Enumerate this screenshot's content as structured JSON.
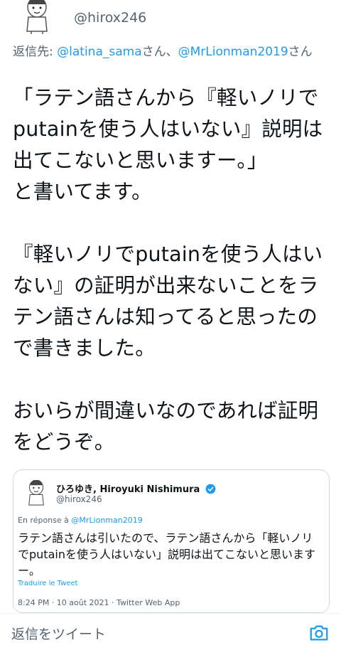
{
  "header": {
    "handle": "@hirox246"
  },
  "reply_to": {
    "prefix": "返信先: ",
    "mention1": "@latina_sama",
    "sep": "さん、",
    "mention2": "@MrLionman2019",
    "suffix": "さん"
  },
  "tweet": {
    "paragraphs": [
      "「ラテン語さんから『軽いノリで\nputainを使う人はいない』説明は\n出てこないと思いますー。」\nと書いてます。",
      "『軽いノリでputainを使う人はい\nない』の証明が出来ないことをラ\nテン語さんは知ってると思ったの\nで書きました。",
      "おいらが間違いなのであれば証明\nをどうぞ。"
    ]
  },
  "quoted_tweet": {
    "name": "ひろゆき, Hiroyuki Nishimura",
    "handle": "@hirox246",
    "reply_prefix": "En réponse à ",
    "reply_mention": "@MrLionman2019",
    "text": "ラテン語さんは引いたので、ラテン語さんから「軽いノリでputainを使う人はいない」説明は出てこないと思いますー。",
    "translate": "Traduire le Tweet",
    "meta": "8:24 PM · 10 août 2021 · Twitter Web App"
  },
  "reply_bar": {
    "placeholder": "返信をツイート"
  },
  "colors": {
    "accent": "#1d9bf0",
    "secondary_text": "#536471",
    "border": "#cfd9de"
  },
  "icons": [
    "avatar",
    "verified-badge-icon",
    "camera-icon"
  ]
}
